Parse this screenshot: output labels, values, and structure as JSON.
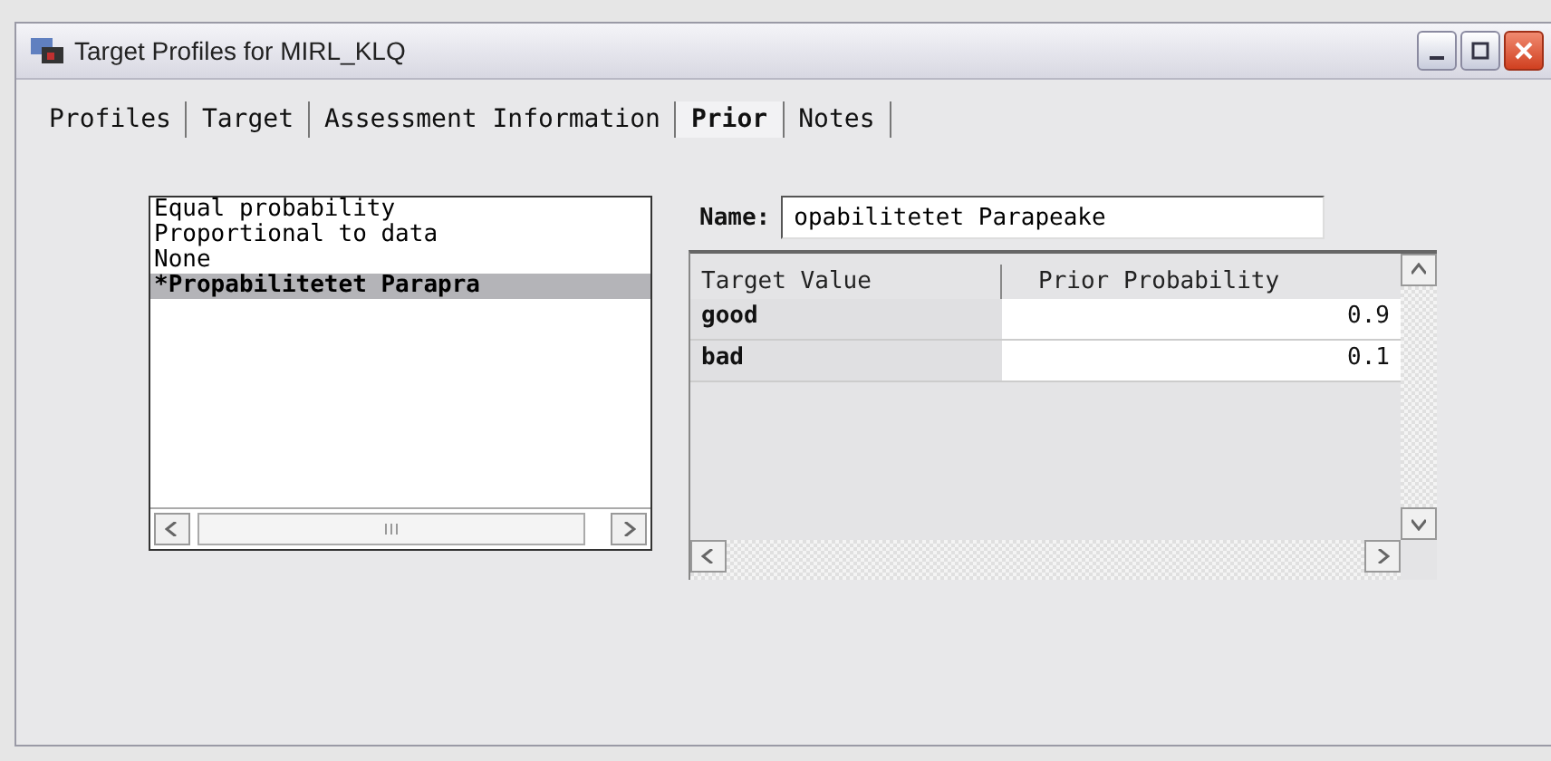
{
  "window": {
    "title": "Target Profiles for MIRL_KLQ"
  },
  "tabs": [
    {
      "label": "Profiles",
      "selected": false
    },
    {
      "label": "Target",
      "selected": false
    },
    {
      "label": "Assessment Information",
      "selected": false
    },
    {
      "label": "Prior",
      "selected": true
    },
    {
      "label": "Notes",
      "selected": false
    }
  ],
  "priors_list": {
    "items": [
      {
        "label": "Equal probability",
        "selected": false
      },
      {
        "label": "Proportional to data",
        "selected": false
      },
      {
        "label": "None",
        "selected": false
      },
      {
        "label": "*Propabilitetet Parapra",
        "selected": true
      }
    ]
  },
  "name_field": {
    "label": "Name:",
    "value": "opabilitetet Parapeake"
  },
  "table": {
    "columns": [
      "Target Value",
      "Prior Probability"
    ],
    "rows": [
      [
        "good",
        "0.9"
      ],
      [
        "bad",
        "0.1"
      ]
    ]
  }
}
